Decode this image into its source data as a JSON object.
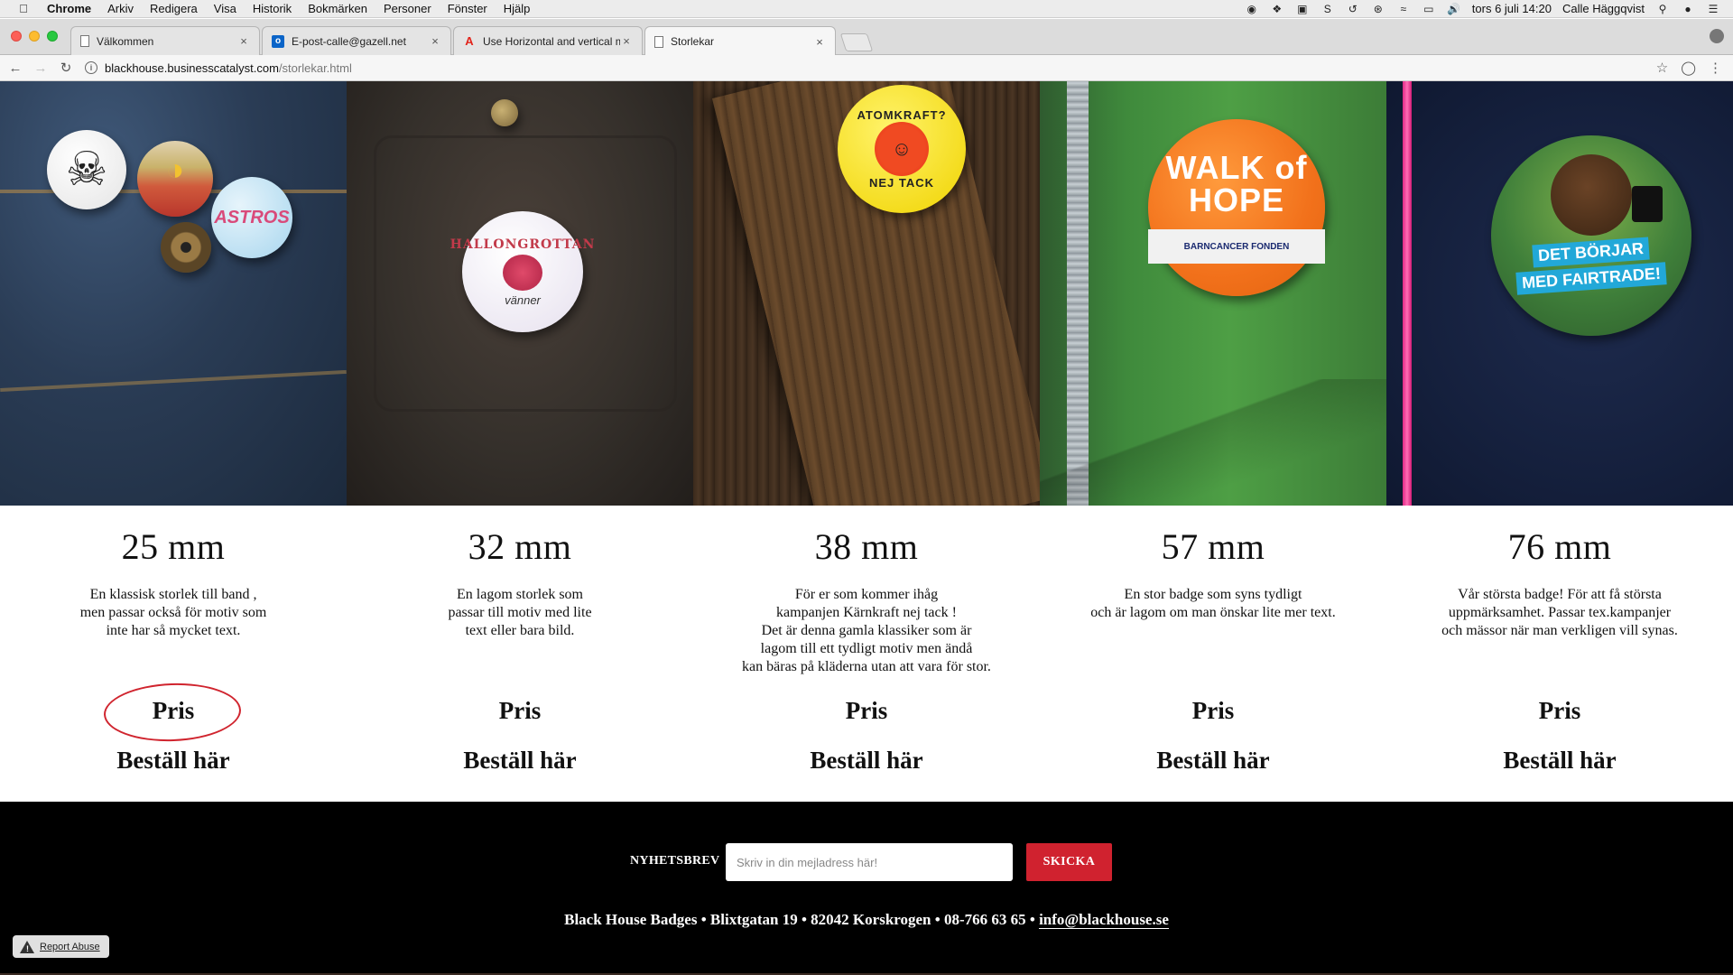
{
  "menubar": {
    "items": [
      "Chrome",
      "Arkiv",
      "Redigera",
      "Visa",
      "Historik",
      "Bokmärken",
      "Personer",
      "Fönster",
      "Hjälp"
    ],
    "clock": "tors 6 juli  14:20",
    "user": "Calle Häggqvist"
  },
  "tabs": [
    {
      "title": "Välkommen",
      "icon": "document-icon",
      "active": false
    },
    {
      "title": "E-post-calle@gazell.net",
      "icon": "outlook-icon",
      "active": false
    },
    {
      "title": "Use Horizontal and vertical me",
      "icon": "adobe-icon",
      "active": false
    },
    {
      "title": "Storlekar",
      "icon": "document-icon",
      "active": true
    }
  ],
  "address": {
    "host": "blackhouse.businesscatalyst.com",
    "path": "/storlekar.html"
  },
  "hero": {
    "badges": {
      "astros": "ASTROS",
      "hallon_word": "HALLONGROTTAN",
      "hallon_vanner": "vänner",
      "atom_top": "ATOMKRAFT?",
      "atom_bottom": "NEJ TACK",
      "walk_line1": "WALK of",
      "walk_line2": "HOPE",
      "walk_band": "BARNCANCER FONDEN",
      "fair_line1": "DET BÖRJAR",
      "fair_line2": "MED FAIRTRADE!"
    }
  },
  "sizes": [
    {
      "size": "25 mm",
      "description": "En klassisk storlek till band ,\nmen passar också för motiv som\ninte har så mycket text.",
      "price_label": "Pris",
      "order_label": "Beställ här"
    },
    {
      "size": "32 mm",
      "description": "En lagom storlek som\npassar till motiv med lite\ntext eller bara bild.",
      "price_label": "Pris",
      "order_label": "Beställ här"
    },
    {
      "size": "38 mm",
      "description": "För er som kommer ihåg\nkampanjen Kärnkraft nej tack !\nDet är denna gamla klassiker som är\nlagom till ett tydligt motiv men ändå\nkan bäras på kläderna utan att vara för stor.",
      "price_label": "Pris",
      "order_label": "Beställ här"
    },
    {
      "size": "57 mm",
      "description": "En stor badge som syns tydligt\noch är lagom om man önskar lite mer text.",
      "price_label": "Pris",
      "order_label": "Beställ här"
    },
    {
      "size": "76 mm",
      "description": "Vår största badge! För att få största\nuppmärksamhet. Passar tex.kampanjer\noch  mässor när man verkligen vill synas.",
      "price_label": "Pris",
      "order_label": "Beställ här"
    }
  ],
  "footer": {
    "newsletter_label": "NYHETSBREV",
    "newsletter_placeholder": "Skriv in din mejladress här!",
    "submit_label": "SKICKA",
    "contact_text": "Black House Badges • Blixtgatan 19 • 82042 Korskrogen • 08-766 63 65 • ",
    "contact_email": "info@blackhouse.se",
    "report_abuse": "Report Abuse"
  },
  "colors": {
    "accent_red": "#d0222f",
    "footer_bg": "#000000"
  }
}
